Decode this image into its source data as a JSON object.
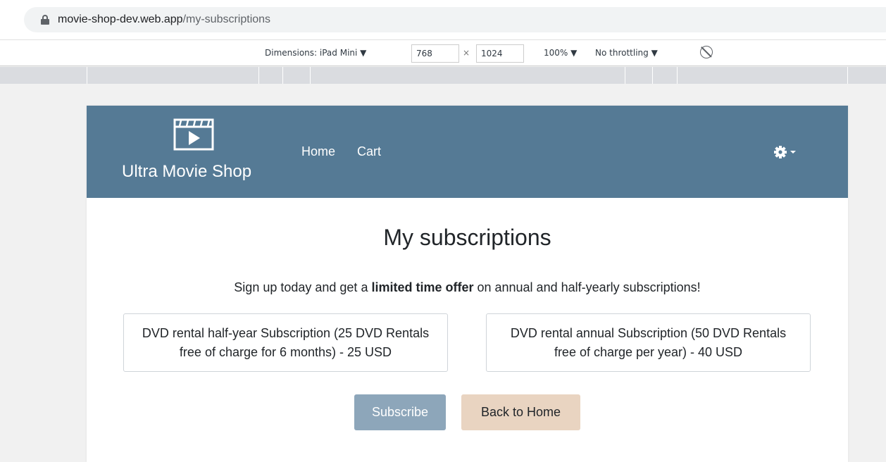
{
  "browser": {
    "url_host": "movie-shop-dev.web.app",
    "url_path": "/my-subscriptions"
  },
  "device_toolbar": {
    "dimensions_label": "Dimensions: iPad Mini ▼",
    "width": "768",
    "times": "×",
    "height": "1024",
    "zoom": "100% ▼",
    "throttling": "No throttling ▼"
  },
  "navbar": {
    "brand": "Ultra Movie Shop",
    "links": [
      "Home",
      "Cart"
    ],
    "colors": {
      "background": "#557a95"
    }
  },
  "main": {
    "title": "My subscriptions",
    "offer_prefix": "Sign up today and get a ",
    "offer_bold": "limited time offer",
    "offer_suffix": " on annual and half-yearly subscriptions!",
    "plans": [
      "DVD rental half-year Subscription (25 DVD Rentals free of charge for 6 months) - 25 USD",
      "DVD rental annual Subscription (50 DVD Rentals free of charge per year) - 40 USD"
    ],
    "subscribe_label": "Subscribe",
    "back_label": "Back to Home",
    "colors": {
      "subscribe": "#8da6ba",
      "back": "#e9d4c1"
    }
  },
  "icons": [
    "lock-icon",
    "rotate-disabled-icon",
    "film-play-icon",
    "gear-icon",
    "caret-down-icon"
  ]
}
